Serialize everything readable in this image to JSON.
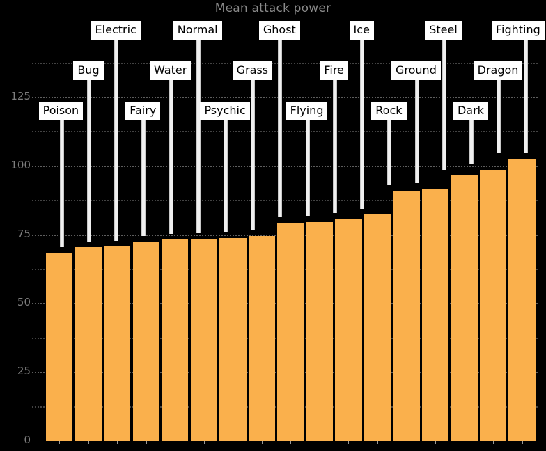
{
  "chart_data": {
    "type": "bar",
    "title": "Mean attack power",
    "xlabel": "",
    "ylabel": "",
    "ylim": [
      0,
      137.5
    ],
    "yticks": [
      0,
      25,
      50,
      75,
      100,
      125
    ],
    "gridlines": [
      12.5,
      25,
      37.5,
      50,
      62.5,
      75,
      87.5,
      100,
      112.5,
      125,
      137.5
    ],
    "grid": true,
    "legend": "none",
    "categories": [
      "Poison",
      "Bug",
      "Fairy",
      "Water",
      "Normal",
      "Psychic",
      "Grass",
      "Ghost",
      "Flying",
      "Ice",
      "Fire",
      "Rock",
      "Ground",
      "Steel",
      "Dark",
      "Dragon",
      "Fighting"
    ],
    "values": [
      68.3,
      70.3,
      70.6,
      72.4,
      73.2,
      73.5,
      73.7,
      74.5,
      79.3,
      79.5,
      80.6,
      82.2,
      90.9,
      91.5,
      96.3,
      98.5,
      102.5
    ],
    "bar_color": "#fab04c",
    "title_color": "#8a8a8a",
    "tick_color": "#7d7d7d",
    "callout_bg": "#ffffff",
    "callout_text_color": "#000000",
    "leader_color": "#f0f0f0"
  },
  "annotations": [
    {
      "label": "Poison",
      "row": 2
    },
    {
      "label": "Bug",
      "row": 1
    },
    {
      "label": "Electric",
      "row": 0
    },
    {
      "label": "Fairy",
      "row": 2
    },
    {
      "label": "Water",
      "row": 1
    },
    {
      "label": "Normal",
      "row": 0
    },
    {
      "label": "Psychic",
      "row": 2
    },
    {
      "label": "Grass",
      "row": 1
    },
    {
      "label": "Ghost",
      "row": 0
    },
    {
      "label": "Flying",
      "row": 2
    },
    {
      "label": "Fire",
      "row": 1
    },
    {
      "label": "Ice",
      "row": 0
    },
    {
      "label": "Rock",
      "row": 2
    },
    {
      "label": "Ground",
      "row": 1
    },
    {
      "label": "Steel",
      "row": 0
    },
    {
      "label": "Dark",
      "row": 2
    },
    {
      "label": "Dragon",
      "row": 1
    },
    {
      "label": "Fighting",
      "row": 0
    }
  ]
}
